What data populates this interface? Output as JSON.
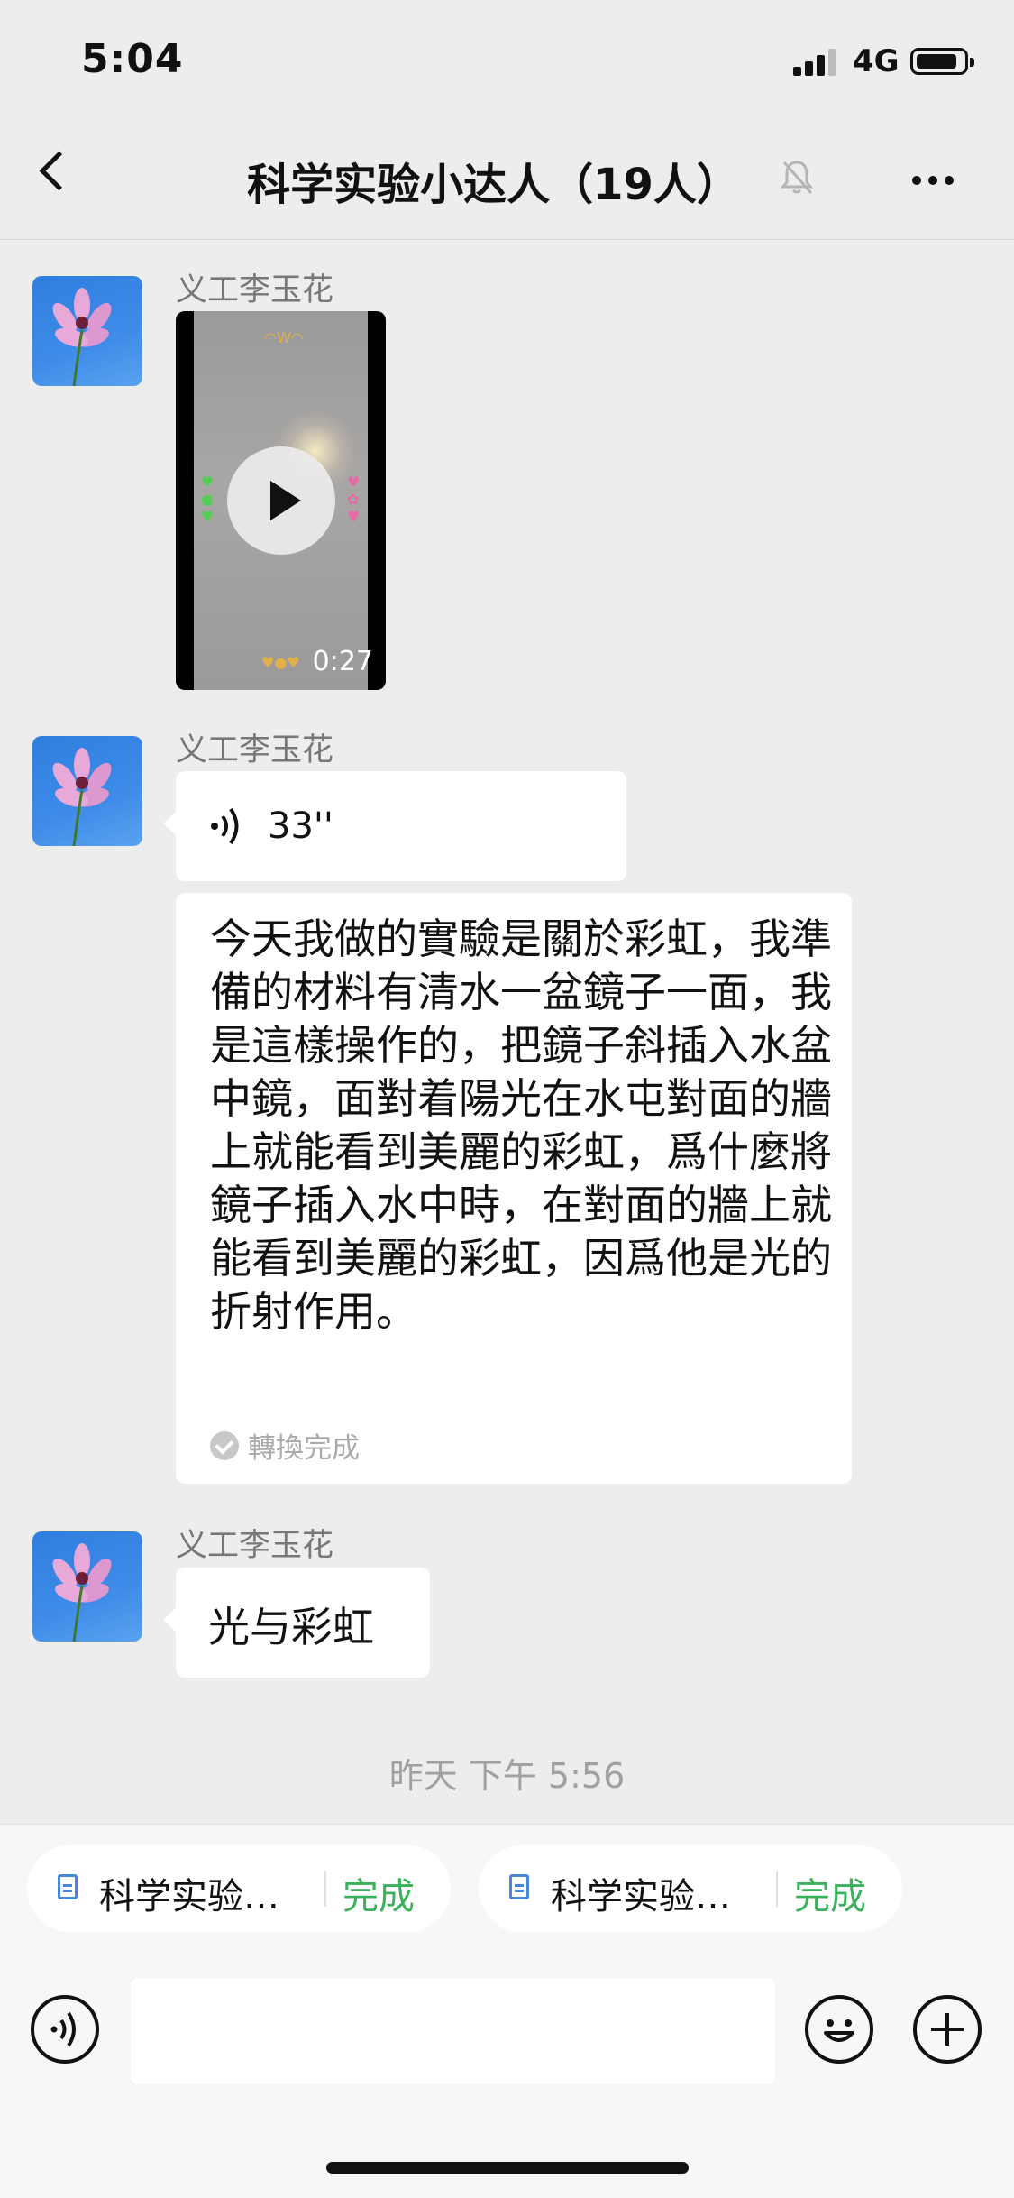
{
  "status_bar": {
    "time": "5:04",
    "network": "4G",
    "battery_level": 0.76,
    "signal_bars": 4
  },
  "nav": {
    "title": "科学实验小达人（19人）",
    "icons": [
      "back-icon",
      "mute-bell-icon",
      "more-icon"
    ]
  },
  "messages": [
    {
      "sender": "义工李玉花",
      "type": "video",
      "duration": "0:27"
    },
    {
      "sender": "义工李玉花",
      "type": "voice",
      "duration": "33''",
      "transcript": "今天我做的實驗是關於彩虹，我準備的材料有清水一盆鏡子一面，我是這樣操作的，把鏡子斜插入水盆中鏡，面對着陽光在水屯對面的牆上就能看到美麗的彩虹，爲什麼將鏡子插入水中時，在對面的牆上就能看到美麗的彩虹，因爲他是光的折射作用。",
      "transcript_status": "轉換完成"
    },
    {
      "sender": "义工李玉花",
      "type": "text",
      "text": "光与彩虹"
    }
  ],
  "timestamp": "昨天 下午 5:56",
  "quick_chips": [
    {
      "name": "科学实验…",
      "state": "完成"
    },
    {
      "name": "科学实验…",
      "state": "完成"
    }
  ],
  "input_bar": {
    "icons": [
      "voice-input-icon",
      "emoji-icon",
      "plus-icon"
    ],
    "value": ""
  },
  "colors": {
    "background": "#ededed",
    "bubble": "#ffffff",
    "done_green": "#3cb15c",
    "avatar_blue": "#3e8be8"
  }
}
